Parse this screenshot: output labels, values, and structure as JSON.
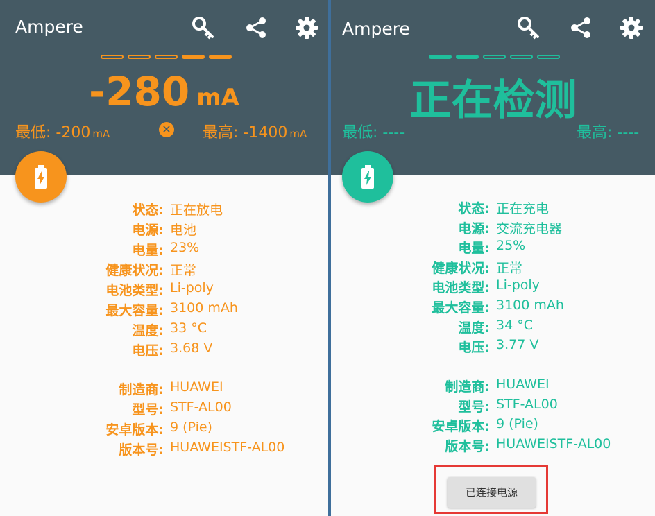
{
  "left": {
    "app_title": "Ampere",
    "current_value": "-280",
    "current_unit": "mA",
    "level_segments_total": 5,
    "level_segments_filled": 2,
    "min_label": "最低: -200",
    "min_unit": "mA",
    "max_label": "最高: -1400",
    "max_unit": "mA",
    "clear_icon_glyph": "✕",
    "accent_color": "#f7941d",
    "info": [
      {
        "key": "状态:",
        "value": "正在放电"
      },
      {
        "key": "电源:",
        "value": "电池"
      },
      {
        "key": "电量:",
        "value": "23%"
      },
      {
        "key": "健康状况:",
        "value": "正常"
      },
      {
        "key": "电池类型:",
        "value": "Li-poly"
      },
      {
        "key": "最大容量:",
        "value": "3100 mAh"
      },
      {
        "key": "温度:",
        "value": "33 °C"
      },
      {
        "key": "电压:",
        "value": "3.68 V"
      }
    ],
    "device": [
      {
        "key": "制造商:",
        "value": "HUAWEI"
      },
      {
        "key": "型号:",
        "value": "STF-AL00"
      },
      {
        "key": "安卓版本:",
        "value": "9 (Pie)"
      },
      {
        "key": "版本号:",
        "value": "HUAWEISTF-AL00"
      }
    ]
  },
  "right": {
    "app_title": "Ampere",
    "current_value": "正在检测",
    "level_segments_total": 5,
    "level_segments_filled": 2,
    "min_label": "最低: ----",
    "max_label": "最高: ----",
    "accent_color": "#1fbf9c",
    "info": [
      {
        "key": "状态:",
        "value": "正在充电"
      },
      {
        "key": "电源:",
        "value": "交流充电器"
      },
      {
        "key": "电量:",
        "value": "25%"
      },
      {
        "key": "健康状况:",
        "value": "正常"
      },
      {
        "key": "电池类型:",
        "value": "Li-poly"
      },
      {
        "key": "最大容量:",
        "value": "3100 mAh"
      },
      {
        "key": "温度:",
        "value": "34 °C"
      },
      {
        "key": "电压:",
        "value": "3.77 V"
      }
    ],
    "device": [
      {
        "key": "制造商:",
        "value": "HUAWEI"
      },
      {
        "key": "型号:",
        "value": "STF-AL00"
      },
      {
        "key": "安卓版本:",
        "value": "9 (Pie)"
      },
      {
        "key": "版本号:",
        "value": "HUAWEISTF-AL00"
      }
    ],
    "connect_button": "已连接电源"
  },
  "icons": {
    "key": "key-icon",
    "share": "share-icon",
    "settings": "gear-icon",
    "battery": "battery-charging-icon"
  },
  "colors": {
    "header_bg": "#455a64",
    "body_bg": "#fafafa",
    "highlight_box": "#e53935"
  }
}
